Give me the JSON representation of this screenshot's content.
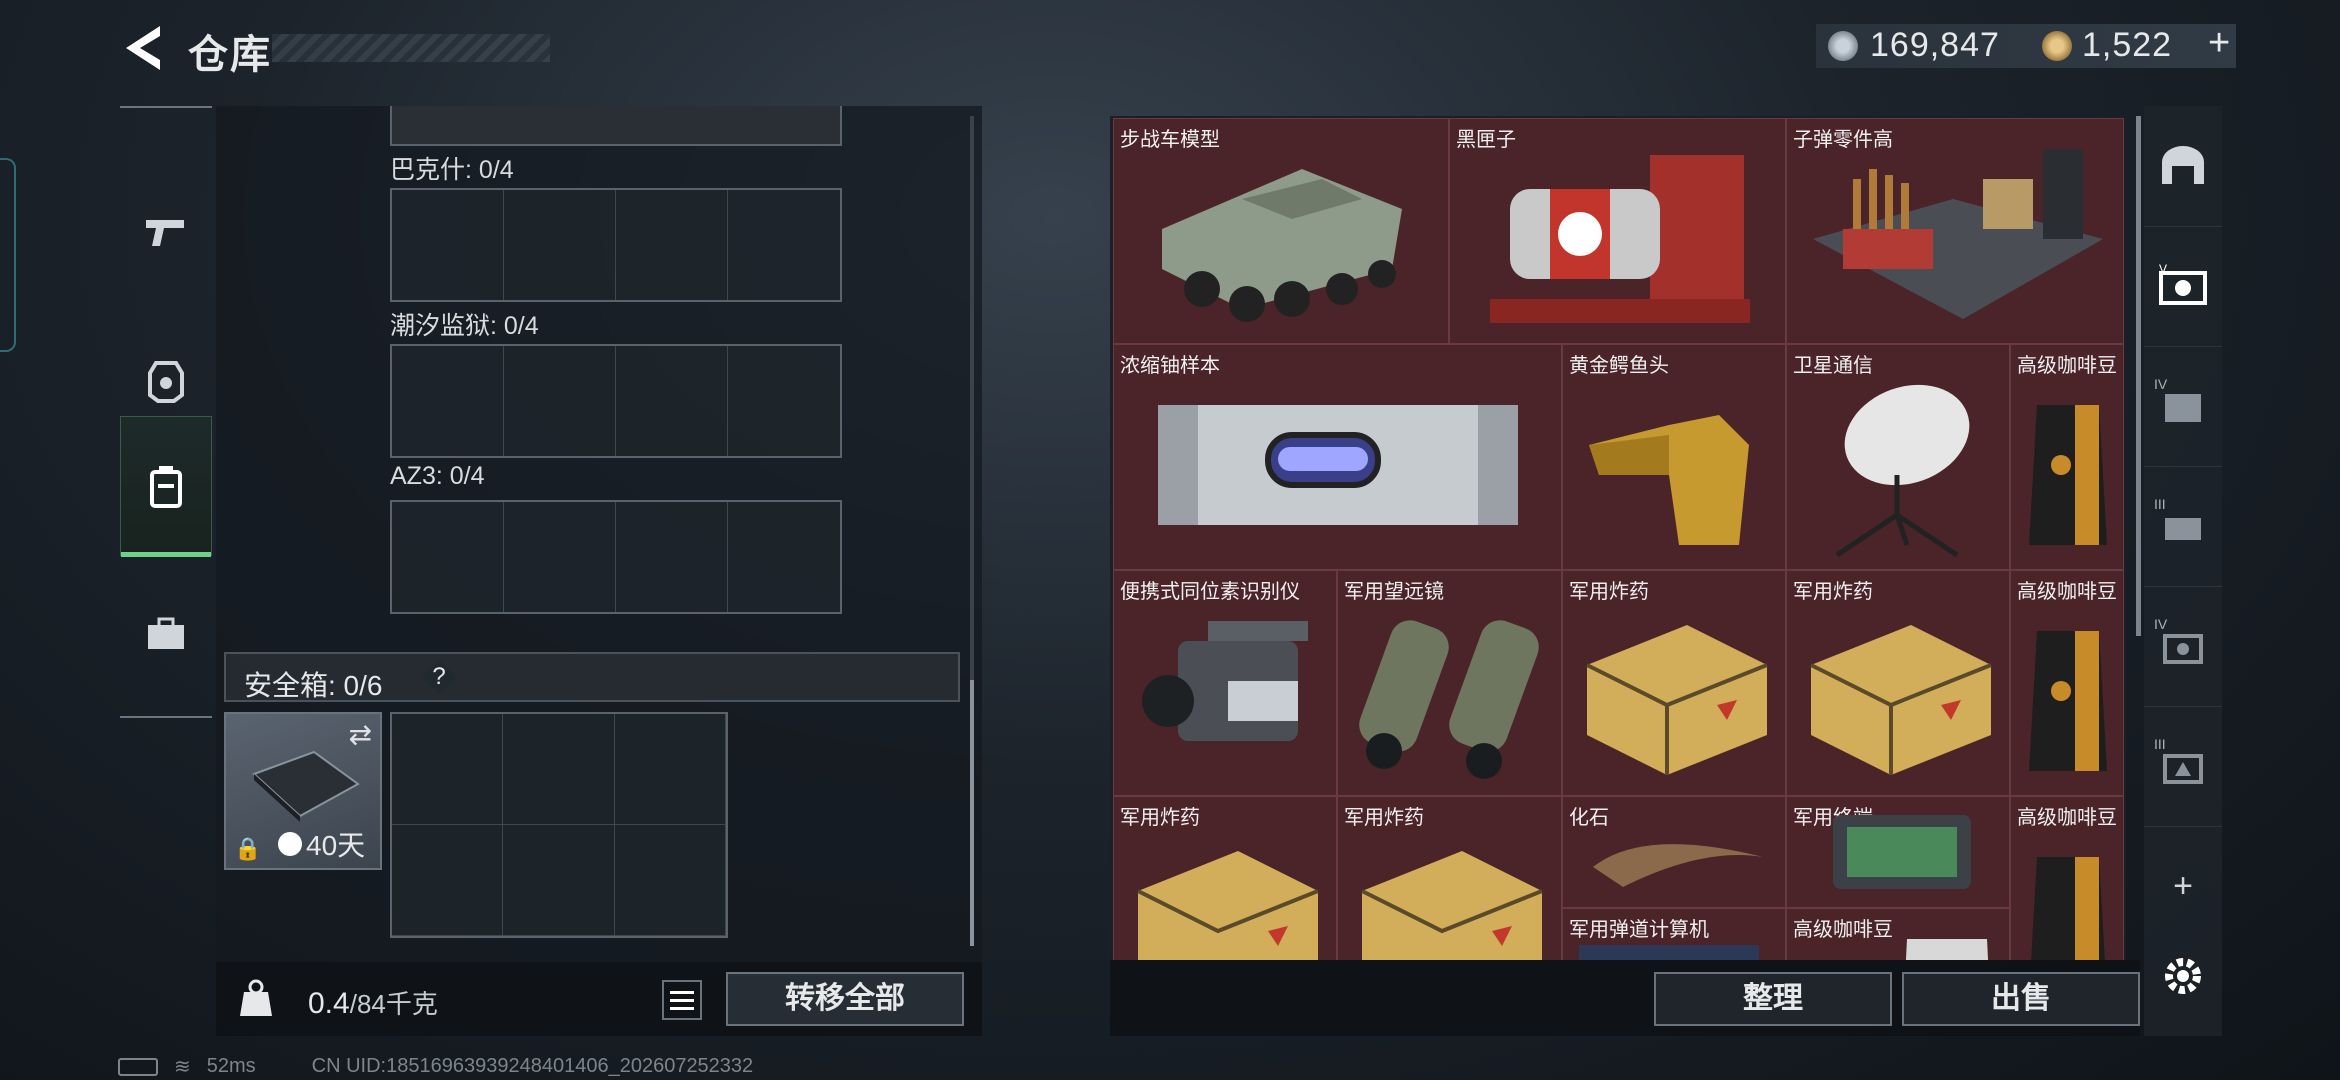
{
  "header": {
    "title": "仓库"
  },
  "currency": {
    "silver": "169,847",
    "gold": "1,522",
    "add": "+"
  },
  "left_nav": {
    "items": [
      "weapon-icon",
      "armor-icon",
      "backpack-icon",
      "briefcase-icon"
    ],
    "active": 2
  },
  "storage_slots": [
    {
      "label": "巴克什: 0/4"
    },
    {
      "label": "潮汐监狱: 0/4"
    },
    {
      "label": "AZ3: 0/4"
    }
  ],
  "safebox": {
    "label": "安全箱: 0/6",
    "help": "?",
    "days": "40天"
  },
  "weight": {
    "current": "0.4",
    "max": "/84千克"
  },
  "buttons": {
    "transfer_all": "转移全部",
    "sort": "整理",
    "sell": "出售"
  },
  "items": [
    {
      "name": "步战车模型",
      "icon": "armored-vehicle-model"
    },
    {
      "name": "黑匣子",
      "icon": "black-box"
    },
    {
      "name": "子弹零件高",
      "icon": "ammo-parts-crate"
    },
    {
      "name": "浓缩铀样本",
      "icon": "uranium-canister"
    },
    {
      "name": "黄金鳄鱼头",
      "icon": "golden-crocodile-head"
    },
    {
      "name": "卫星通信",
      "icon": "satellite-dish"
    },
    {
      "name": "高级咖啡豆",
      "icon": "coffee-bag"
    },
    {
      "name": "便携式同位素识别仪",
      "icon": "isotope-scanner"
    },
    {
      "name": "军用望远镜",
      "icon": "binoculars"
    },
    {
      "name": "军用炸药",
      "icon": "explosive-crate"
    },
    {
      "name": "军用炸药",
      "icon": "explosive-crate"
    },
    {
      "name": "高级咖啡豆",
      "icon": "coffee-bag"
    },
    {
      "name": "军用炸药",
      "icon": "explosive-crate"
    },
    {
      "name": "军用炸药",
      "icon": "explosive-crate"
    },
    {
      "name": "化石",
      "icon": "fossil-claw"
    },
    {
      "name": "军用终端",
      "icon": "military-terminal"
    },
    {
      "name": "高级咖啡豆",
      "icon": "coffee-bag"
    },
    {
      "name": "军用弹道计算机",
      "icon": "ballistic-computer"
    },
    {
      "name": "高级咖啡豆",
      "icon": "coffee-bag"
    }
  ],
  "right_nav": {
    "items": [
      "warehouse-icon",
      "case-v-icon",
      "case-iv-icon",
      "case-iii-icon",
      "case-iv-b-icon",
      "case-iii-b-icon",
      "add-icon"
    ],
    "tier_labels": [
      "IV",
      "III",
      "IV",
      "III"
    ]
  },
  "status_bar": {
    "ping": "52ms",
    "uid": "CN UID:18516963939248401406_202607252332"
  },
  "colors": {
    "item_bg": "#4a2428",
    "accent_green": "#6fd08a"
  }
}
